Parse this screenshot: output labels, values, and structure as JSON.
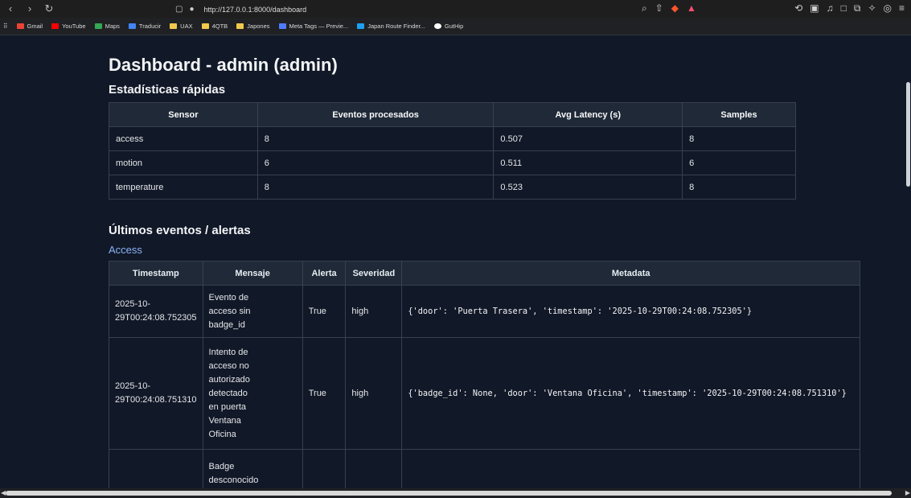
{
  "browser": {
    "url": "http://127.0.0.1:8000/dashboard",
    "bookmarks": [
      "Gmail",
      "YouTube",
      "Maps",
      "Traducir",
      "UAX",
      "4QTB",
      "Japones",
      "Meta Tags — Previe...",
      "Japan Route Finder...",
      "GutHip"
    ]
  },
  "page": {
    "title": "Dashboard - admin (admin)",
    "stats_title": "Estadísticas rápidas",
    "stats_headers": [
      "Sensor",
      "Eventos procesados",
      "Avg Latency (s)",
      "Samples"
    ],
    "stats_rows": [
      [
        "access",
        "8",
        "0.507",
        "8"
      ],
      [
        "motion",
        "6",
        "0.511",
        "6"
      ],
      [
        "temperature",
        "8",
        "0.523",
        "8"
      ]
    ],
    "events_title": "Últimos eventos / alertas",
    "access_label": "Access",
    "events_headers": [
      "Timestamp",
      "Mensaje",
      "Alerta",
      "Severidad",
      "Metadata"
    ],
    "events_rows": [
      {
        "timestamp": "2025-10-\n29T00:24:08.752305",
        "message": "Evento de\nacceso sin\nbadge_id",
        "alert": "True",
        "severity": "high",
        "metadata": "{'door': 'Puerta Trasera', 'timestamp': '2025-10-29T00:24:08.752305'}"
      },
      {
        "timestamp": "2025-10-\n29T00:24:08.751310",
        "message": "Intento de\nacceso no\nautorizado\ndetectado\nen puerta\nVentana\nOficina",
        "alert": "True",
        "severity": "high",
        "metadata": "{'badge_id': None, 'door': 'Ventana Oficina', 'timestamp': '2025-10-29T00:24:08.751310'}"
      },
      {
        "timestamp": "",
        "message": "Badge\ndesconocido",
        "alert": "",
        "severity": "",
        "metadata": ""
      }
    ]
  }
}
